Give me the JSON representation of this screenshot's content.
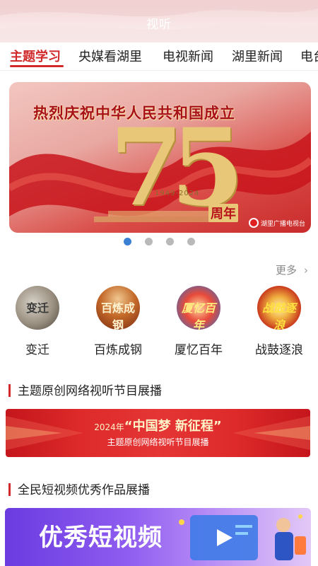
{
  "header": {
    "title": "视听"
  },
  "tabs": [
    {
      "label": "主题学习",
      "active": true
    },
    {
      "label": "央媒看湖里",
      "active": false
    },
    {
      "label": "电视新闻",
      "active": false
    },
    {
      "label": "湖里新闻",
      "active": false
    },
    {
      "label": "电台",
      "active": false
    }
  ],
  "banner": {
    "headline": "热烈庆祝中华人民共和国成立",
    "number": "75",
    "years": "1949-2024",
    "anniversary": "周年",
    "logo_text": "湖里广播电视台",
    "page_count": 4,
    "current_page": 1,
    "colors": {
      "primary": "#c92b2b",
      "gold": "#e8c878",
      "indicator_active": "#3b7fd4"
    }
  },
  "topics": {
    "more_label": "更多",
    "items": [
      {
        "label": "变迁",
        "thumb_text": "变迁"
      },
      {
        "label": "百炼成钢",
        "thumb_text": "百炼成钢"
      },
      {
        "label": "厦忆百年",
        "thumb_text": "厦忆百年"
      },
      {
        "label": "战鼓逐浪",
        "thumb_text": "战鼓逐浪"
      }
    ]
  },
  "section1": {
    "title": "主题原创网络视听节目展播",
    "promo": {
      "year": "2024年",
      "title": "“中国梦 新征程”",
      "subtitle": "主题原创网络视听节目展播"
    }
  },
  "section2": {
    "title": "全民短视频优秀作品展播",
    "promo": {
      "title": "优秀短视频"
    }
  },
  "icons": [
    "chevron-right-icon",
    "play-icon",
    "person-icon"
  ],
  "accent_color": "#d0282b"
}
